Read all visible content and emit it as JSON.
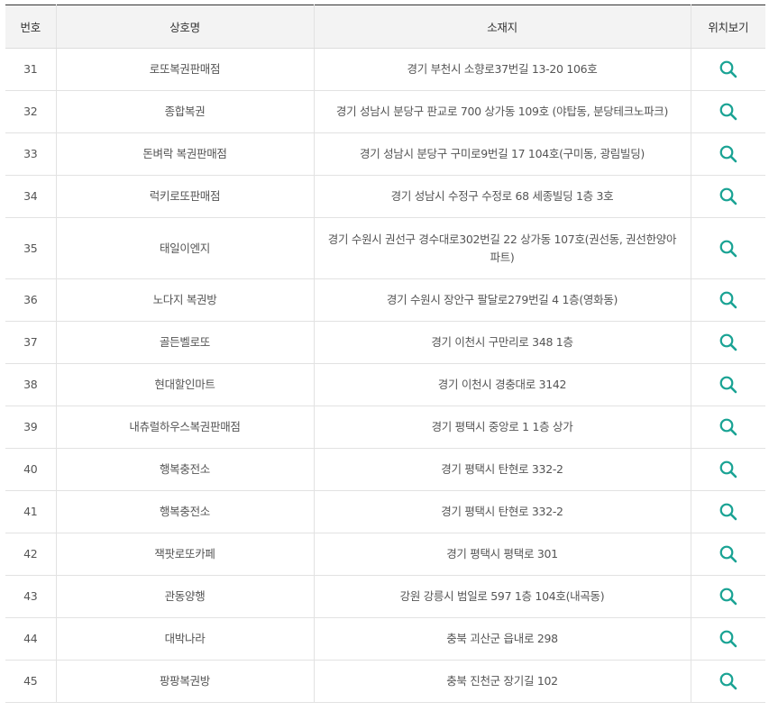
{
  "header": {
    "no": "번호",
    "name": "상호명",
    "address": "소재지",
    "location": "위치보기"
  },
  "icon": {
    "name": "search-icon",
    "color": "#1aa394"
  },
  "rows": [
    {
      "no": "31",
      "name": "로또복권판매점",
      "address": "경기 부천시 소향로37번길 13-20 106호"
    },
    {
      "no": "32",
      "name": "종합복권",
      "address": "경기 성남시 분당구 판교로 700 상가동 109호 (야탑동, 분당테크노파크)"
    },
    {
      "no": "33",
      "name": "돈벼락 복권판매점",
      "address": "경기 성남시 분당구 구미로9번길 17 104호(구미동, 광림빌딩)"
    },
    {
      "no": "34",
      "name": "럭키로또판매점",
      "address": "경기 성남시 수정구 수정로 68 세종빌딩 1층 3호"
    },
    {
      "no": "35",
      "name": "태일이엔지",
      "address": "경기 수원시 권선구 경수대로302번길 22 상가동 107호(권선동, 권선한양아파트)"
    },
    {
      "no": "36",
      "name": "노다지 복권방",
      "address": "경기 수원시 장안구 팔달로279번길 4 1층(영화동)"
    },
    {
      "no": "37",
      "name": "골든벨로또",
      "address": "경기 이천시 구만리로 348 1층"
    },
    {
      "no": "38",
      "name": "현대할인마트",
      "address": "경기 이천시 경충대로 3142"
    },
    {
      "no": "39",
      "name": "내츄럴하우스복권판매점",
      "address": "경기 평택시 중앙로 1 1층 상가"
    },
    {
      "no": "40",
      "name": "행복충전소",
      "address": "경기 평택시 탄현로 332-2"
    },
    {
      "no": "41",
      "name": "행복충전소",
      "address": "경기 평택시 탄현로 332-2"
    },
    {
      "no": "42",
      "name": "잭팟로또카페",
      "address": "경기 평택시 평택로 301"
    },
    {
      "no": "43",
      "name": "관동양행",
      "address": "강원 강릉시 범일로 597 1층 104호(내곡동)"
    },
    {
      "no": "44",
      "name": "대박나라",
      "address": "충북 괴산군 읍내로 298"
    },
    {
      "no": "45",
      "name": "팡팡복권방",
      "address": "충북 진천군 장기길 102"
    }
  ]
}
